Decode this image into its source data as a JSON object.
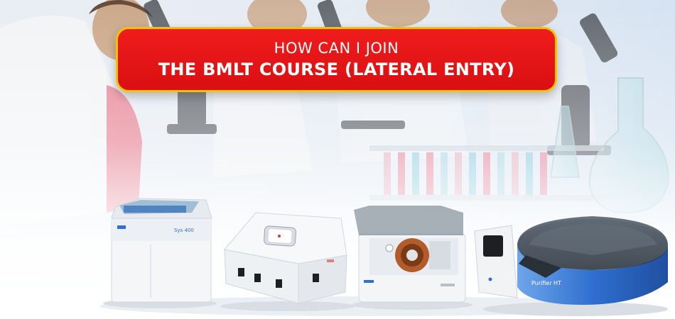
{
  "headline": {
    "line1": "HOW CAN I JOIN",
    "line2": "THE BMLT COURSE (LATERAL ENTRY)"
  },
  "devices": {
    "analyzer_1_badge": "Sys 400",
    "analyzer_4_label": "Purifier HT"
  },
  "colors": {
    "headline_red": "#e3141a",
    "headline_border": "#f4c300",
    "device_blue": "#2f6fd0",
    "background_tint": "#dfe8f3"
  }
}
